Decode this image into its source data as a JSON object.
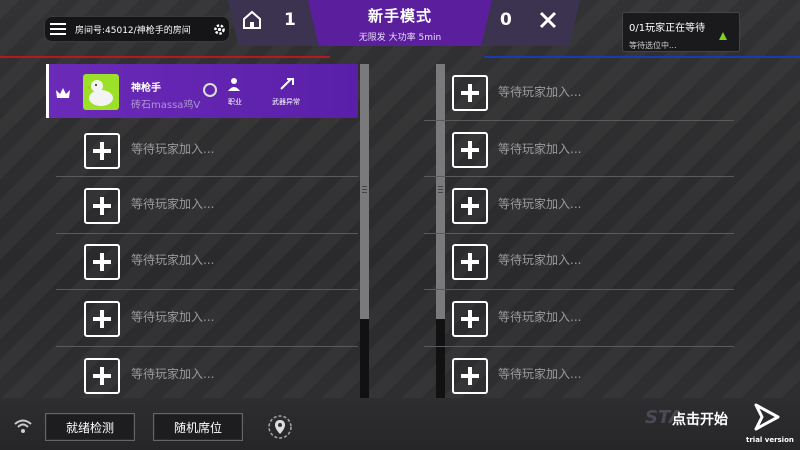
{
  "room": {
    "label": "房间号:45012/神枪手的房间"
  },
  "header": {
    "left_score": "1",
    "right_score": "0",
    "mode_title": "新手模式",
    "mode_subtitle": "无限发 大功率 5min"
  },
  "status": {
    "waiting_title": "0/1玩家正在等待",
    "waiting_sub": "等待选位中..."
  },
  "player": {
    "name": "神枪手",
    "subtitle": "砖石massa鸡V",
    "job_label": "职业",
    "weapon_label": "武器异常"
  },
  "slots": {
    "empty_label": "等待玩家加入..."
  },
  "bottom": {
    "ready_check": "就绪检测",
    "random_seat": "随机席位",
    "start_bg_text": "STA",
    "start_label": "点击开始",
    "trial": "trial version"
  },
  "colors": {
    "accent_purple": "#5b1f9e",
    "team_red": "#b01c1c",
    "team_blue": "#1c3ab0",
    "ready_green": "#7ed321"
  }
}
